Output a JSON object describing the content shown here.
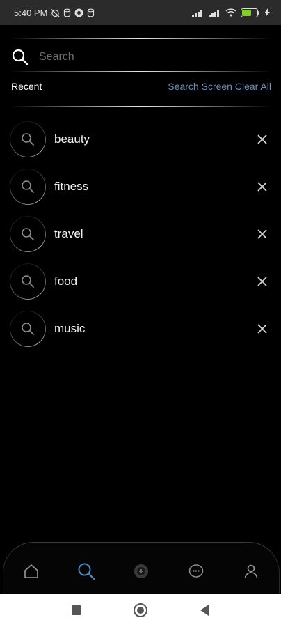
{
  "status_bar": {
    "time": "5:40 PM",
    "battery_level": "54",
    "icons_left": [
      "alarm-off-icon",
      "data-saver-icon",
      "vpn-icon",
      "data-saver-icon"
    ],
    "icons_right": [
      "signal-icon",
      "signal-icon",
      "wifi-icon",
      "battery-icon",
      "charging-icon"
    ]
  },
  "search": {
    "placeholder": "Search",
    "value": ""
  },
  "recent": {
    "title": "Recent",
    "action_label": "Search Screen Clear All",
    "items": [
      {
        "label": "beauty"
      },
      {
        "label": "fitness"
      },
      {
        "label": "travel"
      },
      {
        "label": "food"
      },
      {
        "label": "music"
      }
    ]
  },
  "bottom_nav": {
    "items": [
      "home-icon",
      "search-icon",
      "explore-icon",
      "chat-icon",
      "profile-icon"
    ],
    "active": "search-icon"
  },
  "system_nav": {
    "items": [
      "recents-icon",
      "home-icon",
      "back-icon"
    ]
  },
  "colors": {
    "background": "#000000",
    "status_bar": "#2b2b2b",
    "accent": "#4a90c8",
    "link": "#6f8fb0",
    "text": "#f2f2f2",
    "muted": "#6f6f6f",
    "battery": "#7ed321"
  }
}
